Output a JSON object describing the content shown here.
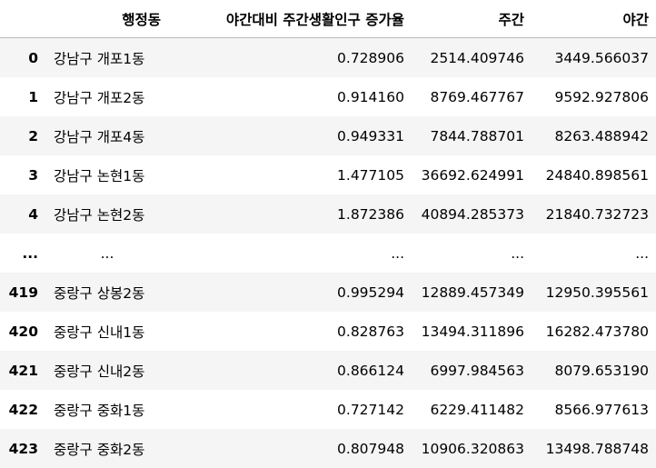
{
  "columns": {
    "index": "",
    "dong": "행정동",
    "ratio": "야간대비 주간생활인구 증가율",
    "day": "주간",
    "night": "야간"
  },
  "rows": [
    {
      "index": "0",
      "dong": "강남구 개포1동",
      "ratio": "0.728906",
      "day": "2514.409746",
      "night": "3449.566037"
    },
    {
      "index": "1",
      "dong": "강남구 개포2동",
      "ratio": "0.914160",
      "day": "8769.467767",
      "night": "9592.927806"
    },
    {
      "index": "2",
      "dong": "강남구 개포4동",
      "ratio": "0.949331",
      "day": "7844.788701",
      "night": "8263.488942"
    },
    {
      "index": "3",
      "dong": "강남구 논현1동",
      "ratio": "1.477105",
      "day": "36692.624991",
      "night": "24840.898561"
    },
    {
      "index": "4",
      "dong": "강남구 논현2동",
      "ratio": "1.872386",
      "day": "40894.285373",
      "night": "21840.732723"
    },
    {
      "index": "...",
      "dong": "...",
      "ratio": "...",
      "day": "...",
      "night": "..."
    },
    {
      "index": "419",
      "dong": "중랑구 상봉2동",
      "ratio": "0.995294",
      "day": "12889.457349",
      "night": "12950.395561"
    },
    {
      "index": "420",
      "dong": "중랑구 신내1동",
      "ratio": "0.828763",
      "day": "13494.311896",
      "night": "16282.473780"
    },
    {
      "index": "421",
      "dong": "중랑구 신내2동",
      "ratio": "0.866124",
      "day": "6997.984563",
      "night": "8079.653190"
    },
    {
      "index": "422",
      "dong": "중랑구 중화1동",
      "ratio": "0.727142",
      "day": "6229.411482",
      "night": "8566.977613"
    },
    {
      "index": "423",
      "dong": "중랑구 중화2동",
      "ratio": "0.807948",
      "day": "10906.320863",
      "night": "13498.788748"
    }
  ]
}
